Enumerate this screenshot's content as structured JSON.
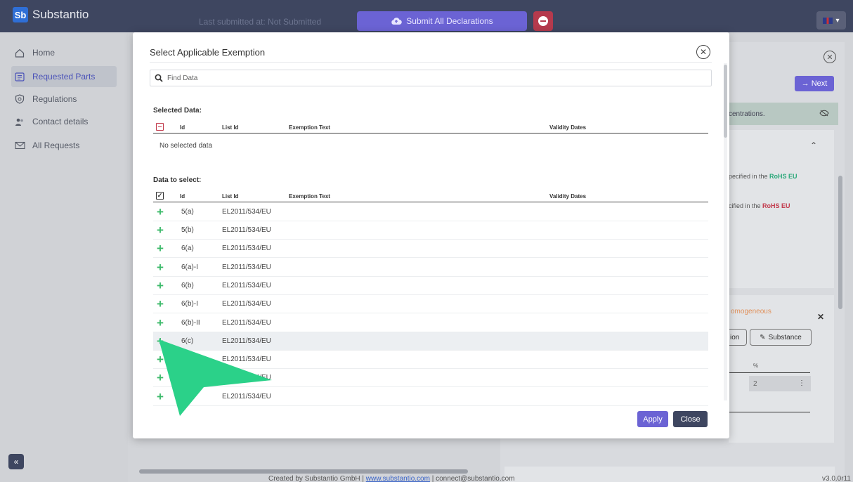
{
  "app": {
    "brand_logo": "Sb",
    "brand_name": "Substantio",
    "last_submitted": "Last submitted at: Not Submitted",
    "submit_all_label": "Submit All Declarations",
    "accent_color": "#6b63d4",
    "danger_color": "#c23a4c",
    "add_color": "#3cba6a"
  },
  "sidebar": {
    "items": [
      {
        "label": "Home",
        "icon": "home-icon"
      },
      {
        "label": "Requested Parts",
        "icon": "list-icon",
        "active": true
      },
      {
        "label": "Regulations",
        "icon": "shield-icon"
      },
      {
        "label": "Contact details",
        "icon": "contacts-icon"
      },
      {
        "label": "All Requests",
        "icon": "mail-icon"
      }
    ],
    "collapse_label": "«"
  },
  "right_panel": {
    "next_label": "Next",
    "info_text": "centrations.",
    "text1_prefix": "pecified in the ",
    "text2_prefix": "cified in the ",
    "rohs": "RoHS EU",
    "homogeneous": "omogeneous",
    "btn_ion": "ion",
    "btn_substance": "Substance",
    "pct_header": "%",
    "pct_value": "2"
  },
  "modal": {
    "title": "Select Applicable Exemption",
    "search_placeholder": "Find Data",
    "selected_title": "Selected Data:",
    "to_select_title": "Data to select:",
    "columns": {
      "id": "Id",
      "list_id": "List Id",
      "exemption_text": "Exemption Text",
      "validity_dates": "Validity Dates"
    },
    "no_selected": "No selected data",
    "rows": [
      {
        "id": "5(a)",
        "list_id": "EL2011/534/EU"
      },
      {
        "id": "5(b)",
        "list_id": "EL2011/534/EU"
      },
      {
        "id": "6(a)",
        "list_id": "EL2011/534/EU"
      },
      {
        "id": "6(a)-I",
        "list_id": "EL2011/534/EU"
      },
      {
        "id": "6(b)",
        "list_id": "EL2011/534/EU"
      },
      {
        "id": "6(b)-I",
        "list_id": "EL2011/534/EU"
      },
      {
        "id": "6(b)-II",
        "list_id": "EL2011/534/EU"
      },
      {
        "id": "6(c)",
        "list_id": "EL2011/534/EU"
      },
      {
        "id": "6(c)",
        "list_id": "EL2011/534/EU"
      },
      {
        "id": "",
        "list_id": "EL2011/534/EU"
      },
      {
        "id": "c)-I",
        "list_id": "EL2011/534/EU"
      }
    ],
    "apply_label": "Apply",
    "close_label": "Close"
  },
  "footer": {
    "created_by": "Created by Substantio GmbH | ",
    "website": "www.substantio.com",
    "contact": " | connect@substantio.com",
    "version": "v3.0.0r11"
  }
}
